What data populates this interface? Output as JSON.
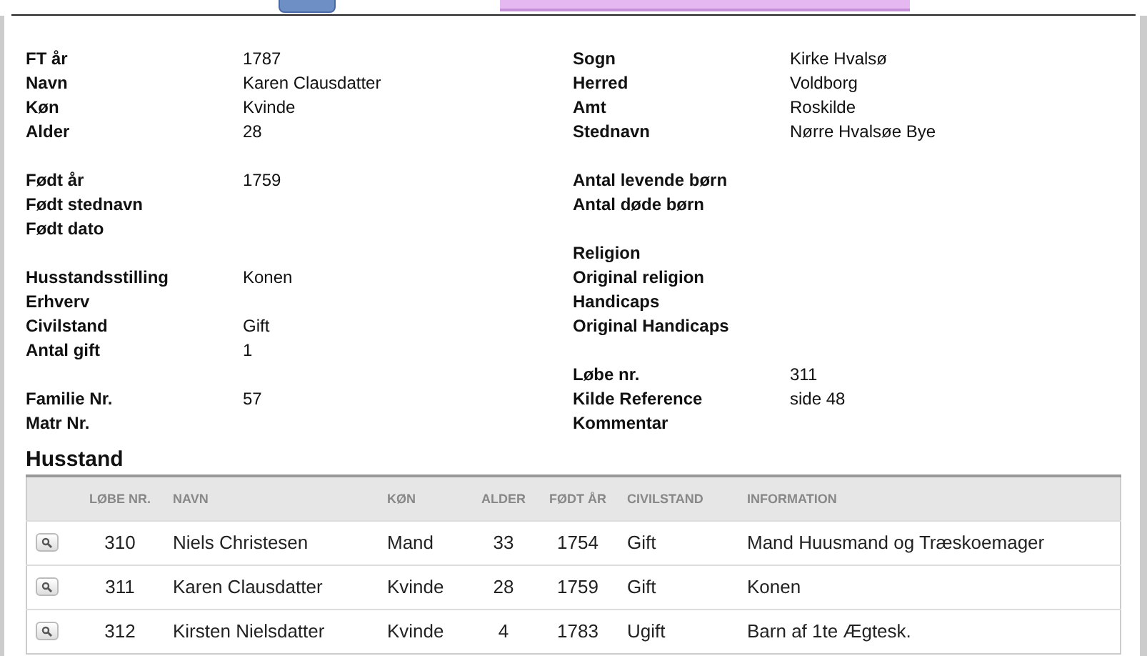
{
  "details_left": [
    {
      "fields": [
        {
          "label": "FT år",
          "value": "1787"
        },
        {
          "label": "Navn",
          "value": "Karen Clausdatter"
        },
        {
          "label": "Køn",
          "value": "Kvinde"
        },
        {
          "label": "Alder",
          "value": "28"
        }
      ]
    },
    {
      "fields": [
        {
          "label": "Født år",
          "value": "1759"
        },
        {
          "label": "Født stednavn"
        },
        {
          "label": "Født dato"
        }
      ]
    },
    {
      "fields": [
        {
          "label": "Husstandsstilling",
          "value": "Konen"
        },
        {
          "label": "Erhverv"
        },
        {
          "label": "Civilstand",
          "value": "Gift"
        },
        {
          "label": "Antal gift",
          "value": "1"
        }
      ]
    },
    {
      "fields": [
        {
          "label": "Familie Nr.",
          "value": "57"
        },
        {
          "label": "Matr Nr."
        }
      ]
    }
  ],
  "details_right": [
    {
      "fields": [
        {
          "label": "Sogn",
          "value": "Kirke Hvalsø"
        },
        {
          "label": "Herred",
          "value": "Voldborg"
        },
        {
          "label": "Amt",
          "value": "Roskilde"
        },
        {
          "label": "Stednavn",
          "value": "Nørre Hvalsøe Bye"
        }
      ]
    },
    {
      "fields": [
        {
          "label": "Antal levende børn"
        },
        {
          "label": "Antal døde børn"
        }
      ]
    },
    {
      "fields": [
        {
          "label": "Religion"
        },
        {
          "label": "Original religion"
        },
        {
          "label": "Handicaps"
        },
        {
          "label": "Original Handicaps"
        }
      ]
    },
    {
      "fields": [
        {
          "label": "Løbe nr.",
          "value": "311"
        },
        {
          "label": "Kilde Reference",
          "value": "side 48"
        },
        {
          "label": "Kommentar"
        }
      ]
    }
  ],
  "household": {
    "title": "Husstand",
    "columns": [
      "LØBE NR.",
      "NAVN",
      "KØN",
      "ALDER",
      "FØDT ÅR",
      "CIVILSTAND",
      "INFORMATION"
    ],
    "rows": [
      [
        "310",
        "Niels Christesen",
        "Mand",
        "33",
        "1754",
        "Gift",
        "Mand Huusmand og Træskoemager"
      ],
      [
        "311",
        "Karen Clausdatter",
        "Kvinde",
        "28",
        "1759",
        "Gift",
        "Konen"
      ],
      [
        "312",
        "Kirsten Nielsdatter",
        "Kvinde",
        "4",
        "1783",
        "Ugift",
        "Barn af 1te Ægtesk."
      ]
    ]
  }
}
